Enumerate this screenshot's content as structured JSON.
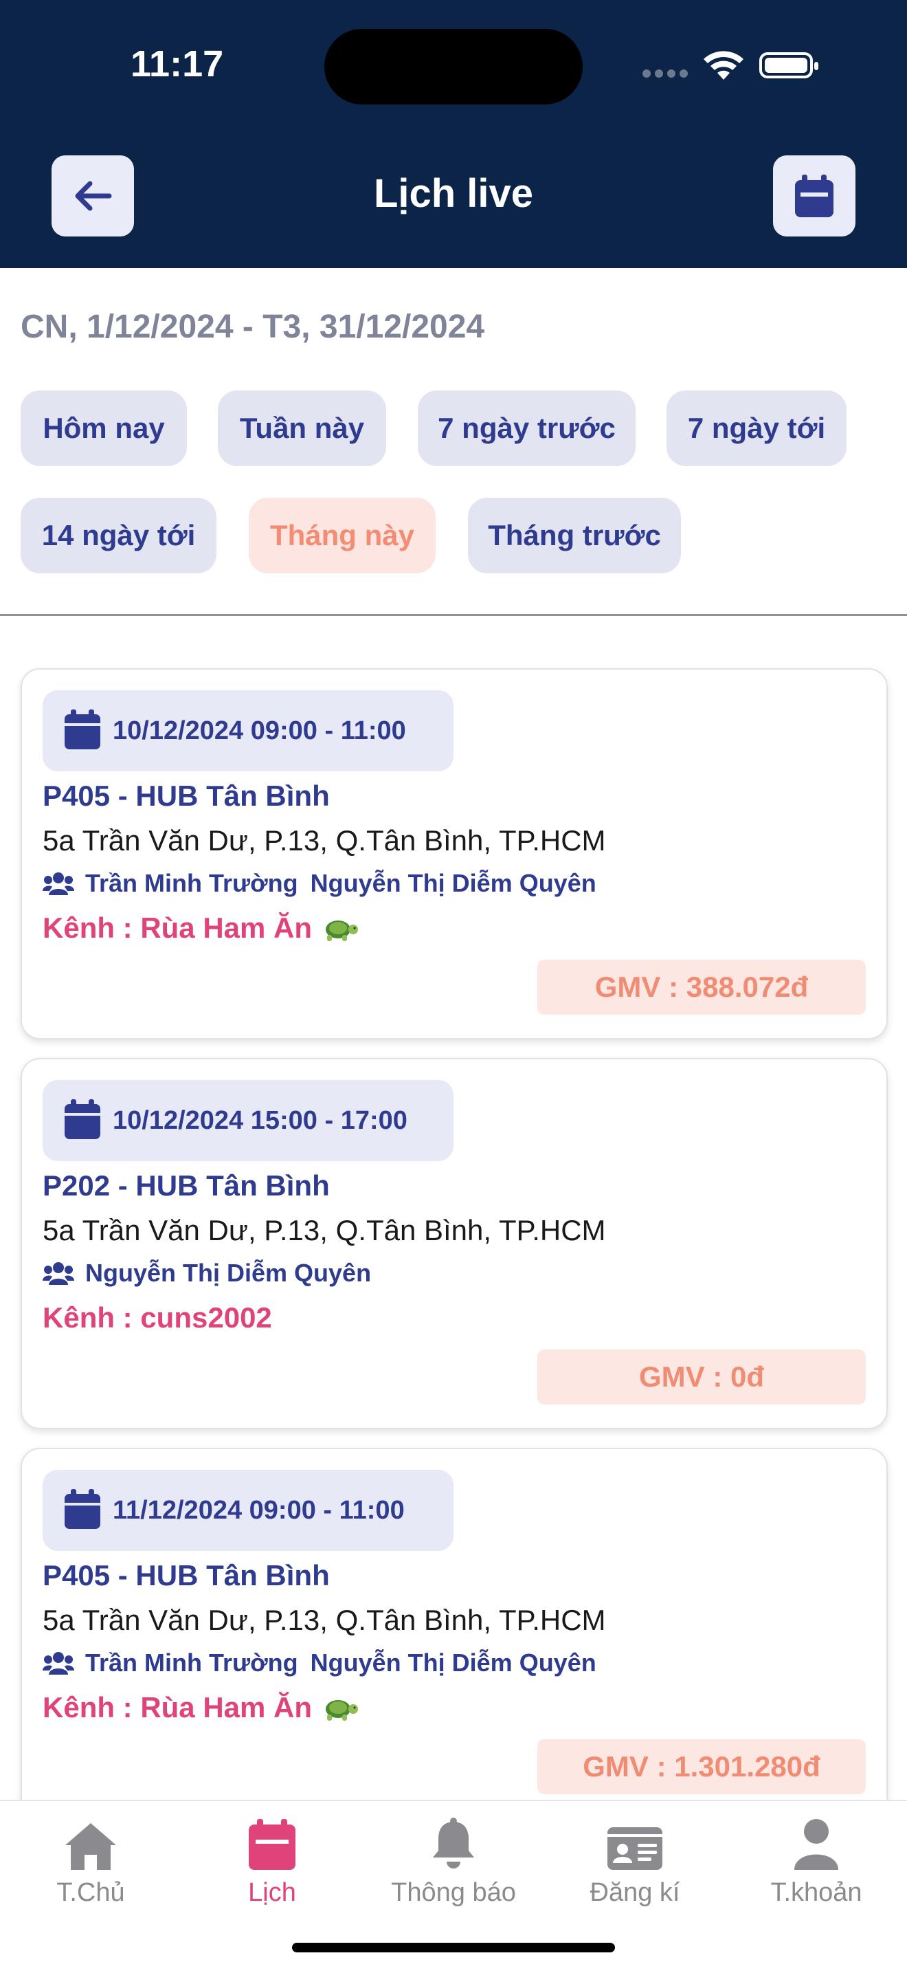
{
  "status_bar": {
    "time": "11:17"
  },
  "header": {
    "title": "Lịch live"
  },
  "date_range": "CN, 1/12/2024  - T3, 31/12/2024",
  "filters": [
    {
      "label": "Hôm nay",
      "active": false
    },
    {
      "label": "Tuần này",
      "active": false
    },
    {
      "label": "7 ngày trước",
      "active": false
    },
    {
      "label": "7 ngày tới",
      "active": false
    },
    {
      "label": "14 ngày tới",
      "active": false
    },
    {
      "label": "Tháng này",
      "active": true
    },
    {
      "label": "Tháng trước",
      "active": false
    }
  ],
  "sessions": [
    {
      "datetime": "10/12/2024  09:00 - 11:00",
      "room": "P405 - HUB Tân Bình",
      "address": "5a Trần Văn Dư, P.13, Q.Tân Bình, TP.HCM",
      "hosts": [
        "Trần Minh Trường",
        "Nguyễn Thị Diễm Quyên"
      ],
      "channel": "Kênh : Rùa Ham Ăn",
      "channel_emoji": "turtle",
      "gmv": "GMV : 388.072đ"
    },
    {
      "datetime": "10/12/2024  15:00 - 17:00",
      "room": "P202 - HUB Tân Bình",
      "address": "5a Trần Văn Dư, P.13, Q.Tân Bình, TP.HCM",
      "hosts": [
        "Nguyễn Thị Diễm Quyên"
      ],
      "channel": "Kênh : cuns2002",
      "channel_emoji": "",
      "gmv": "GMV : 0đ"
    },
    {
      "datetime": "11/12/2024  09:00 - 11:00",
      "room": "P405 - HUB Tân Bình",
      "address": "5a Trần Văn Dư, P.13, Q.Tân Bình, TP.HCM",
      "hosts": [
        "Trần Minh Trường",
        "Nguyễn Thị Diễm Quyên"
      ],
      "channel": "Kênh : Rùa Ham Ăn",
      "channel_emoji": "turtle",
      "gmv": "GMV : 1.301.280đ"
    }
  ],
  "tabbar": [
    {
      "label": "T.Chủ",
      "icon": "home-icon",
      "active": false
    },
    {
      "label": "Lịch",
      "icon": "calendar-icon",
      "active": true
    },
    {
      "label": "Thông báo",
      "icon": "bell-icon",
      "active": false
    },
    {
      "label": "Đăng kí",
      "icon": "id-card-icon",
      "active": false
    },
    {
      "label": "T.khoản",
      "icon": "user-icon",
      "active": false
    }
  ],
  "colors": {
    "header_bg": "#0b2447",
    "primary": "#2e3b8f",
    "accent": "#e0437a",
    "gmv_text": "#f18c74"
  }
}
